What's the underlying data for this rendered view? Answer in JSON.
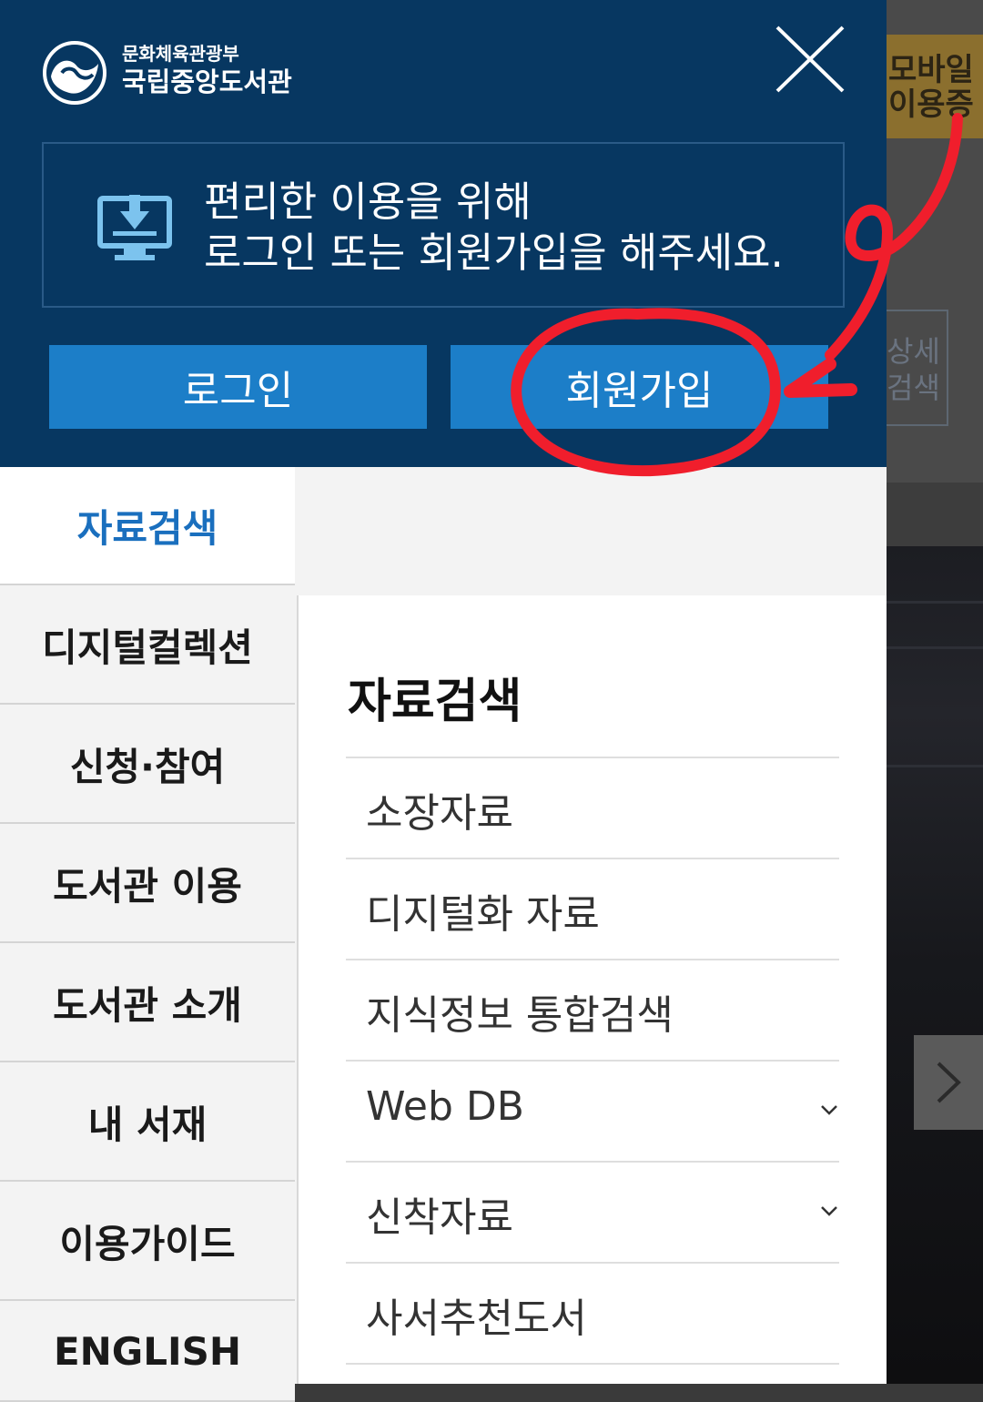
{
  "background": {
    "mobile_card_text": "모바일\n이용증",
    "search_text": "상세\n검색",
    "next_icon": "chevron-right-icon"
  },
  "header": {
    "ministry": "문화체육관광부",
    "library": "국립중앙도서관",
    "close_icon": "close-icon",
    "notice_line1": "편리한 이용을 위해",
    "notice_line2": "로그인 또는 회원가입을 해주세요.",
    "login_label": "로그인",
    "signup_label": "회원가입"
  },
  "left_menu": {
    "items": [
      {
        "label": "자료검색"
      },
      {
        "label": "디지털컬렉션"
      },
      {
        "label": "신청·참여"
      },
      {
        "label": "도서관 이용"
      },
      {
        "label": "도서관 소개"
      },
      {
        "label": "내 서재"
      },
      {
        "label": "이용가이드"
      },
      {
        "label": "ENGLISH"
      }
    ]
  },
  "submenu": {
    "title": "자료검색",
    "items": [
      {
        "label": "소장자료"
      },
      {
        "label": "디지털화 자료"
      },
      {
        "label": "지식정보 통합검색"
      },
      {
        "label": "Web DB"
      },
      {
        "label": "신착자료"
      },
      {
        "label": "사서추천도서"
      }
    ]
  },
  "colors": {
    "header_bg": "#073761",
    "button_blue": "#1c7ec8",
    "active_text": "#1a6fbe",
    "annotation_red": "#f01e2c"
  }
}
